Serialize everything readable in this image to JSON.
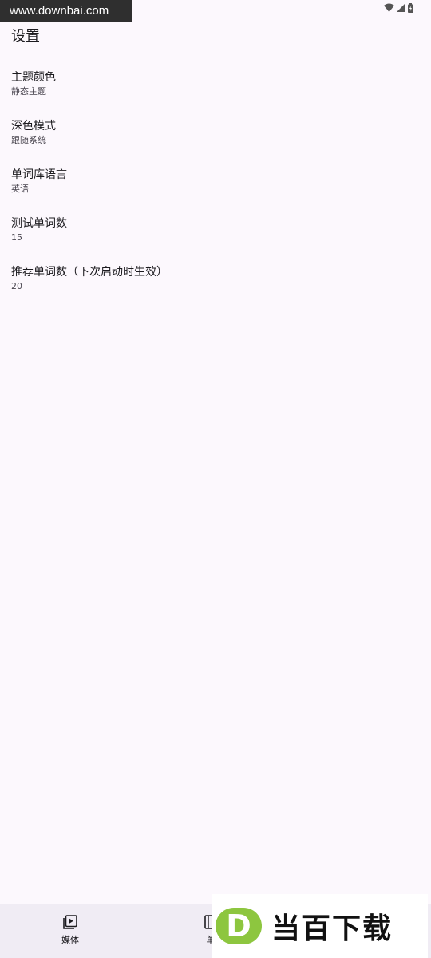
{
  "watermark_top": "www.downbai.com",
  "page": {
    "title": "设置"
  },
  "settings": [
    {
      "title": "主题颜色",
      "value": "静态主题"
    },
    {
      "title": "深色模式",
      "value": "跟随系统"
    },
    {
      "title": "单词库语言",
      "value": "英语"
    },
    {
      "title": "测试单词数",
      "value": "15"
    },
    {
      "title": "推荐单词数（下次启动时生效）",
      "value": "20"
    }
  ],
  "bottom_nav": [
    {
      "label": "媒体",
      "icon": "video-library-icon"
    },
    {
      "label": "单",
      "icon": "book-icon"
    }
  ],
  "watermark_logo": {
    "letter": "D",
    "text": "当百下载"
  },
  "colors": {
    "background": "#fcf8fd",
    "nav_background": "#f0ecf4",
    "logo_green": "#8dc63f"
  }
}
